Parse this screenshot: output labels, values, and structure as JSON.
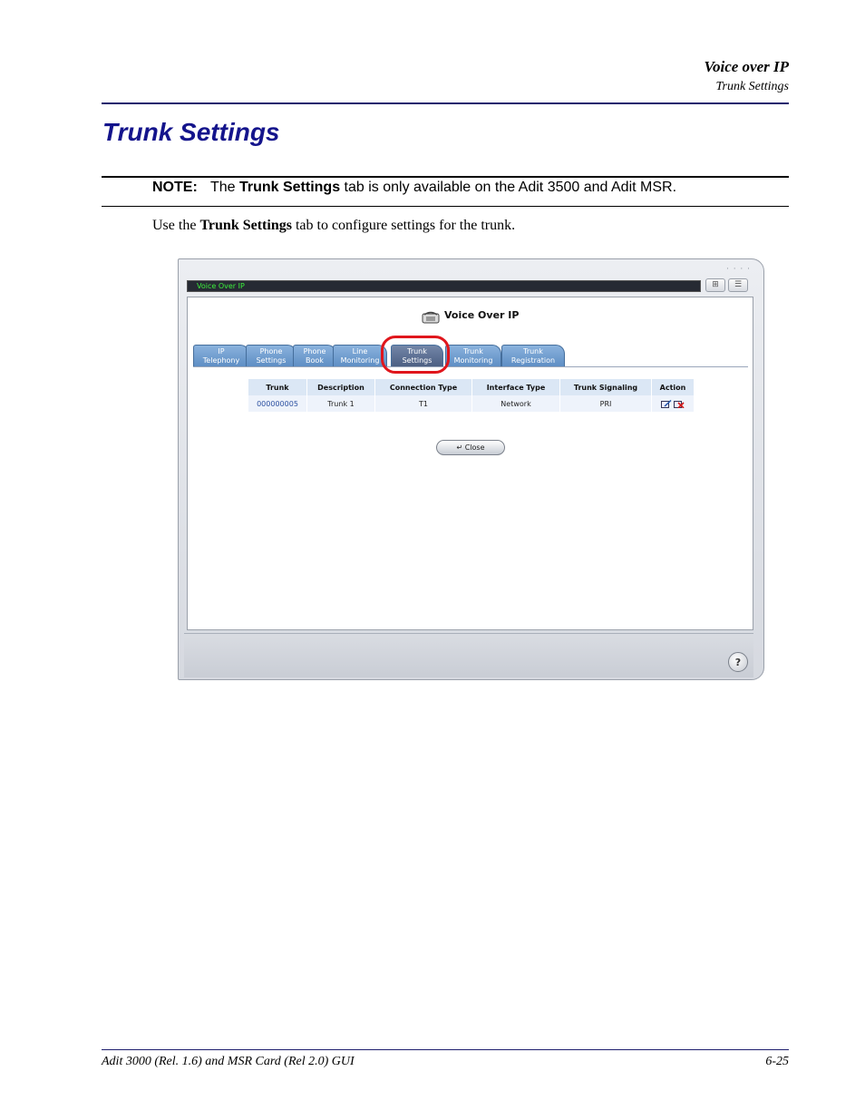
{
  "header": {
    "section": "Voice over IP",
    "subsection": "Trunk Settings"
  },
  "page_title": "Trunk Settings",
  "note": {
    "label": "NOTE:",
    "pre": "The",
    "bold": "Trunk Settings",
    "post": "tab is only available on the Adit 3500 and Adit MSR."
  },
  "body": {
    "pre": "Use the",
    "bold": "Trunk Settings",
    "post": "tab to configure settings for the trunk."
  },
  "screenshot": {
    "window_title": "Voice Over IP",
    "heading": "Voice Over IP",
    "tabs": [
      {
        "l1": "IP",
        "l2": "Telephony"
      },
      {
        "l1": "Phone",
        "l2": "Settings"
      },
      {
        "l1": "Phone",
        "l2": "Book"
      },
      {
        "l1": "Line",
        "l2": "Monitoring"
      },
      {
        "l1": "Trunk",
        "l2": "Settings"
      },
      {
        "l1": "Trunk",
        "l2": "Monitoring"
      },
      {
        "l1": "Trunk",
        "l2": "Registration"
      }
    ],
    "table": {
      "headers": [
        "Trunk",
        "Description",
        "Connection Type",
        "Interface Type",
        "Trunk Signaling",
        "Action"
      ],
      "rows": [
        [
          "000000005",
          "Trunk 1",
          "T1",
          "Network",
          "PRI"
        ]
      ]
    },
    "close_label": "Close",
    "help_label": "?",
    "colors": {
      "window_title_text": "#3cf03c",
      "tab": "#6e9ccf",
      "tab_active": "#5a6d91",
      "highlight_ring": "#e0161c"
    }
  },
  "footer": {
    "left": "Adit 3000 (Rel. 1.6) and MSR Card (Rel 2.0) GUI",
    "right": "6-25"
  }
}
